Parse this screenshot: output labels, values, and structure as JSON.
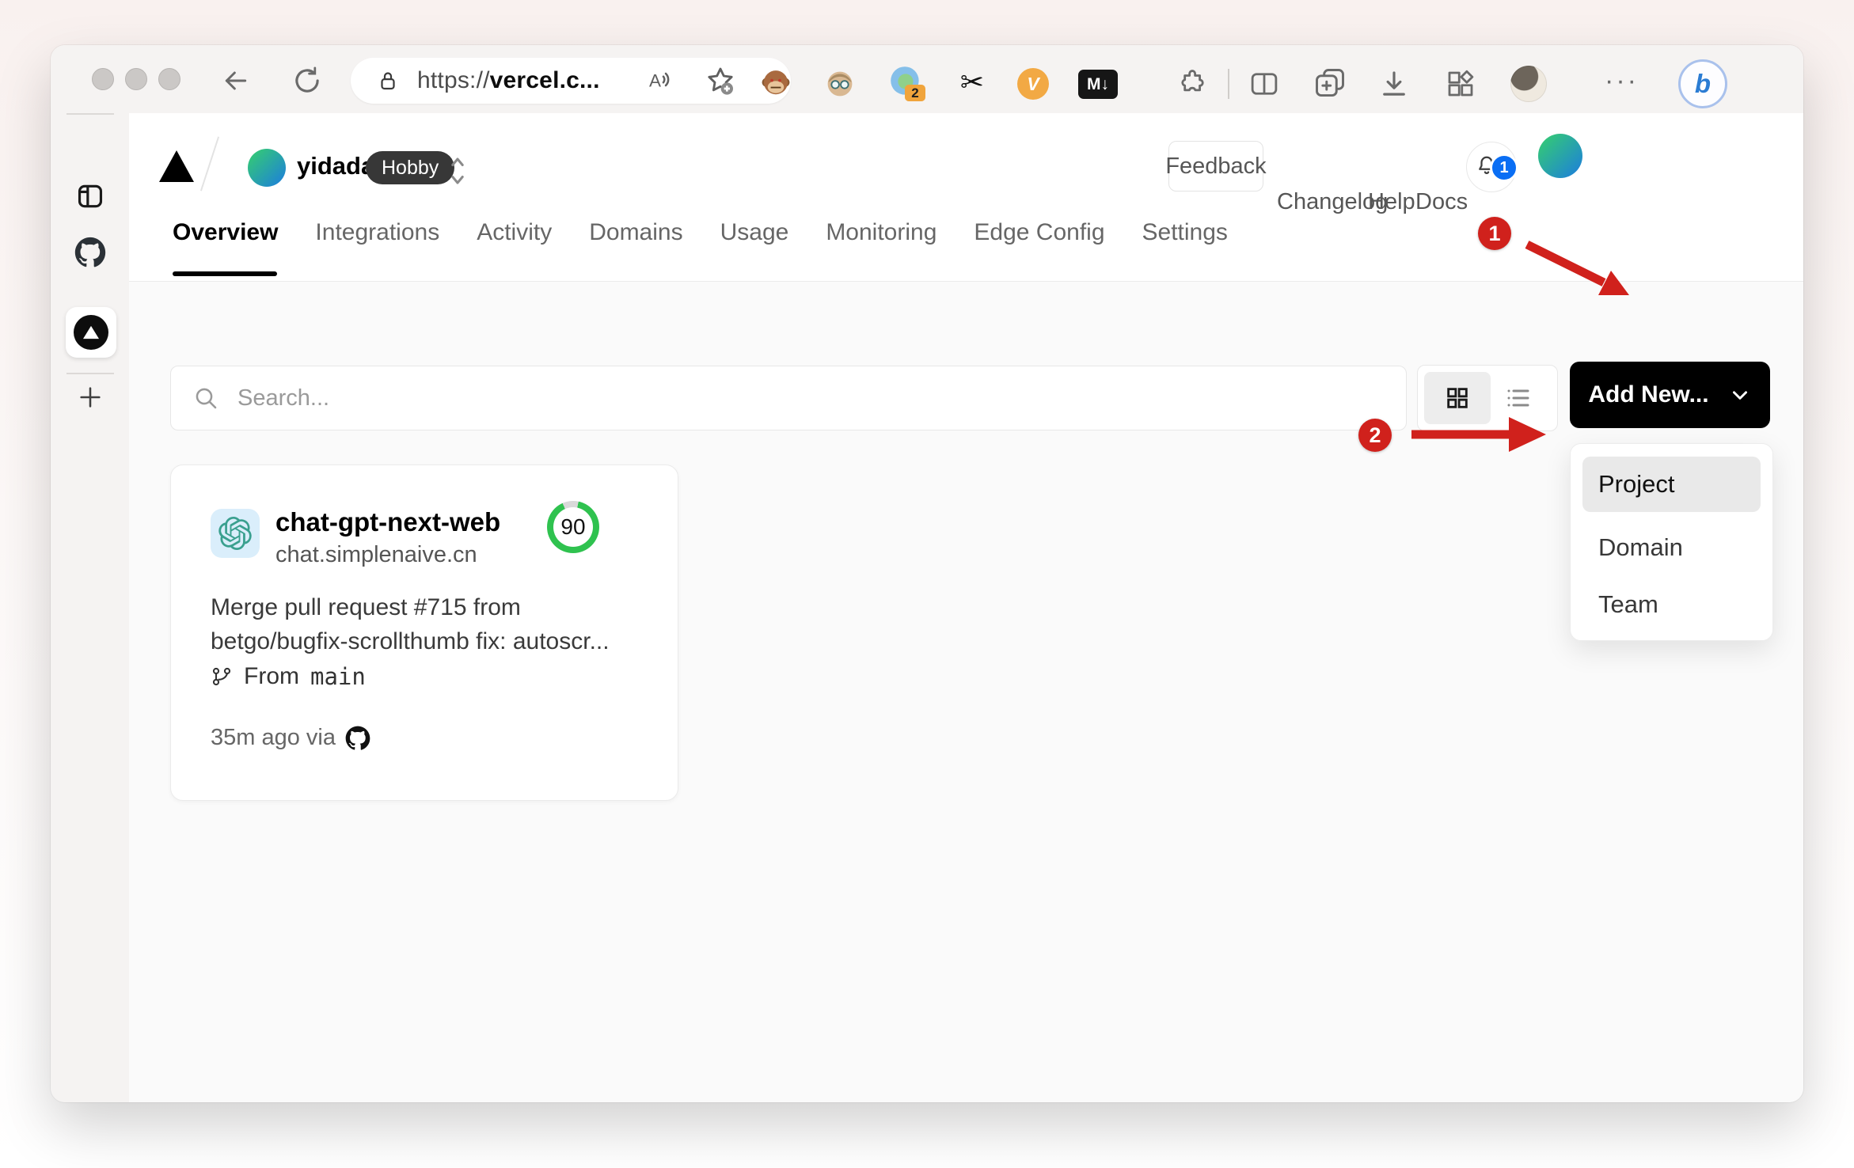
{
  "browser": {
    "url_scheme": "https://",
    "url_domain": "vercel.c...",
    "tab_badge": "2",
    "scissors_glyph": "✂",
    "vc_ext_label": "V",
    "markdown_ext_label": "M↓",
    "bing_label": "b",
    "more_glyph": "···"
  },
  "header": {
    "team_name": "yidadaa",
    "plan_badge": "Hobby",
    "links": [
      "Feedback",
      "Changelog",
      "Help",
      "Docs"
    ],
    "notification_count": "1"
  },
  "tabs": [
    "Overview",
    "Integrations",
    "Activity",
    "Domains",
    "Usage",
    "Monitoring",
    "Edge Config",
    "Settings"
  ],
  "controls": {
    "search_placeholder": "Search...",
    "add_new_label": "Add New..."
  },
  "dropdown": {
    "items": [
      "Project",
      "Domain",
      "Team"
    ]
  },
  "project_card": {
    "name": "chat-gpt-next-web",
    "domain": "chat.simplenaive.cn",
    "score": "90",
    "commit_line1": "Merge pull request #715 from",
    "commit_line2": "betgo/bugfix-scrollthumb fix: autoscr...",
    "from_label": "From",
    "branch": "main",
    "meta": "35m ago via"
  },
  "annotations": {
    "step1": "1",
    "step2": "2"
  },
  "colors": {
    "annotation_red": "#d0211c",
    "add_new_bg": "#000000",
    "score_green": "#2fc24f",
    "notification_blue": "#0a6ef4",
    "plan_badge_bg": "#373737"
  }
}
